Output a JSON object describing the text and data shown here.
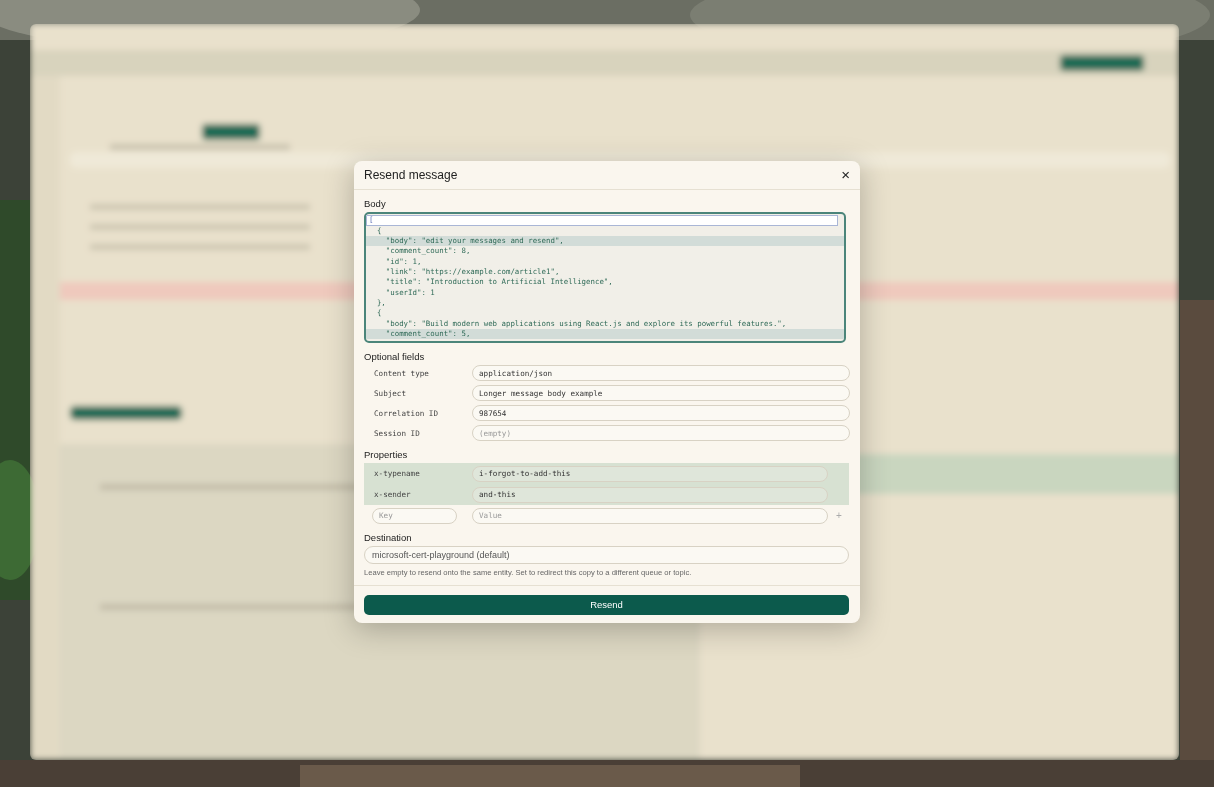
{
  "dialog": {
    "title": "Resend message",
    "close_icon": "×"
  },
  "body": {
    "label": "Body",
    "lines": [
      {
        "text": "[",
        "active": true,
        "highlighted": false
      },
      {
        "text": "  {",
        "active": false,
        "highlighted": false
      },
      {
        "text": "    \"body\": \"edit your messages and resend\",",
        "active": false,
        "highlighted": true
      },
      {
        "text": "    \"comment_count\": 8,",
        "active": false,
        "highlighted": false
      },
      {
        "text": "    \"id\": 1,",
        "active": false,
        "highlighted": false
      },
      {
        "text": "    \"link\": \"https://example.com/article1\",",
        "active": false,
        "highlighted": false
      },
      {
        "text": "    \"title\": \"Introduction to Artificial Intelligence\",",
        "active": false,
        "highlighted": false
      },
      {
        "text": "    \"userId\": 1",
        "active": false,
        "highlighted": false
      },
      {
        "text": "  },",
        "active": false,
        "highlighted": false
      },
      {
        "text": "  {",
        "active": false,
        "highlighted": false
      },
      {
        "text": "    \"body\": \"Build modern web applications using React.js and explore its powerful features.\",",
        "active": false,
        "highlighted": false
      },
      {
        "text": "    \"comment_count\": 5,",
        "active": false,
        "highlighted": true
      }
    ]
  },
  "optional_fields": {
    "label": "Optional fields",
    "fields": [
      {
        "label": "Content type",
        "value": "application/json"
      },
      {
        "label": "Subject",
        "value": "Longer message body example"
      },
      {
        "label": "Correlation ID",
        "value": "987654"
      },
      {
        "label": "Session ID",
        "placeholder": "(empty)"
      }
    ]
  },
  "properties": {
    "label": "Properties",
    "rows": [
      {
        "key": "x-typename",
        "value": "i-forgot-to-add-this",
        "changed": true
      },
      {
        "key": "x-sender",
        "value": "and-this",
        "changed": true
      }
    ],
    "new_row": {
      "key_placeholder": "Key",
      "value_placeholder": "Value",
      "add_icon": "+"
    }
  },
  "destination": {
    "label": "Destination",
    "placeholder": "microsoft-cert-playground (default)",
    "hint": "Leave empty to resend onto the same entity. Set to redirect this copy to a different queue or topic."
  },
  "buttons": [
    "Resend"
  ]
}
